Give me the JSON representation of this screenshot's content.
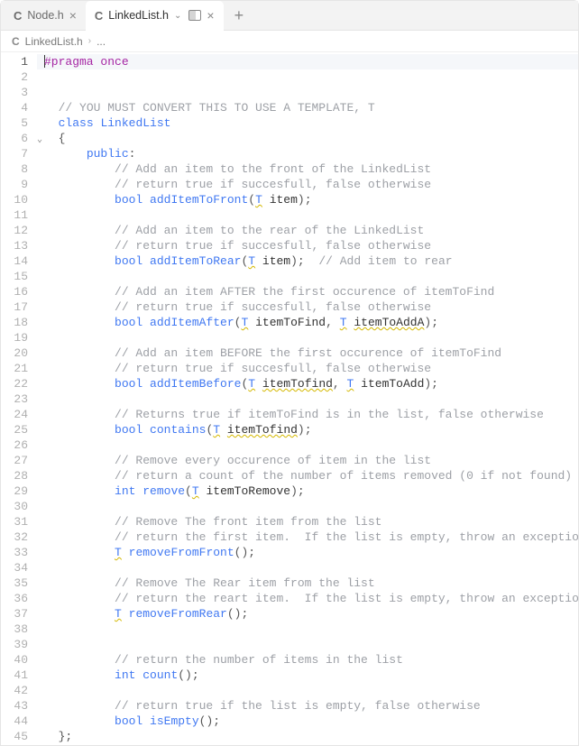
{
  "tabs": [
    {
      "icon": "C",
      "label": "Node.h",
      "active": false
    },
    {
      "icon": "C",
      "label": "LinkedList.h",
      "active": true
    }
  ],
  "breadcrumb": {
    "icon": "C",
    "file": "LinkedList.h",
    "sep": "›",
    "rest": "..."
  },
  "new_tab_label": "+",
  "active_line": 1,
  "fold_line": 6,
  "line_count": 45,
  "code_lines": [
    [
      {
        "c": "cursor"
      },
      {
        "c": "kw-pre",
        "t": "#pragma"
      },
      {
        "t": " "
      },
      {
        "c": "kw-mod",
        "t": "once"
      }
    ],
    [],
    [],
    [
      {
        "t": "  "
      },
      {
        "c": "cm",
        "t": "// YOU MUST CONVERT THIS TO USE A TEMPLATE, T"
      }
    ],
    [
      {
        "t": "  "
      },
      {
        "c": "kw-class",
        "t": "class"
      },
      {
        "t": " "
      },
      {
        "c": "kw-type",
        "t": "LinkedList"
      }
    ],
    [
      {
        "t": "  "
      },
      {
        "c": "pn",
        "t": "{"
      }
    ],
    [
      {
        "t": "      "
      },
      {
        "c": "kw-scope",
        "t": "public"
      },
      {
        "c": "pn",
        "t": ":"
      }
    ],
    [
      {
        "t": "          "
      },
      {
        "c": "cm",
        "t": "// Add an item to the front of the LinkedList"
      }
    ],
    [
      {
        "t": "          "
      },
      {
        "c": "cm",
        "t": "// return true if succesfull, false otherwise"
      }
    ],
    [
      {
        "t": "          "
      },
      {
        "c": "kw-type",
        "t": "bool"
      },
      {
        "t": " "
      },
      {
        "c": "fn",
        "t": "addItemToFront"
      },
      {
        "c": "pn",
        "t": "("
      },
      {
        "c": "ty",
        "t": "T"
      },
      {
        "t": " item"
      },
      {
        "c": "pn",
        "t": ");"
      }
    ],
    [],
    [
      {
        "t": "          "
      },
      {
        "c": "cm",
        "t": "// Add an item to the rear of the LinkedList"
      }
    ],
    [
      {
        "t": "          "
      },
      {
        "c": "cm",
        "t": "// return true if succesfull, false otherwise"
      }
    ],
    [
      {
        "t": "          "
      },
      {
        "c": "kw-type",
        "t": "bool"
      },
      {
        "t": " "
      },
      {
        "c": "fn",
        "t": "addItemToRear"
      },
      {
        "c": "pn",
        "t": "("
      },
      {
        "c": "ty",
        "t": "T"
      },
      {
        "t": " item"
      },
      {
        "c": "pn",
        "t": ");"
      },
      {
        "t": "  "
      },
      {
        "c": "cm",
        "t": "// Add item to rear"
      }
    ],
    [],
    [
      {
        "t": "          "
      },
      {
        "c": "cm",
        "t": "// Add an item AFTER the first occurence of itemToFind"
      }
    ],
    [
      {
        "t": "          "
      },
      {
        "c": "cm",
        "t": "// return true if succesfull, false otherwise"
      }
    ],
    [
      {
        "t": "          "
      },
      {
        "c": "kw-type",
        "t": "bool"
      },
      {
        "t": " "
      },
      {
        "c": "fn",
        "t": "addItemAfter"
      },
      {
        "c": "pn",
        "t": "("
      },
      {
        "c": "ty",
        "t": "T"
      },
      {
        "t": " itemToFind"
      },
      {
        "c": "pn",
        "t": ","
      },
      {
        "t": " "
      },
      {
        "c": "ty",
        "t": "T"
      },
      {
        "t": " "
      },
      {
        "c": "warn-u",
        "t": "itemToAddA"
      },
      {
        "c": "pn",
        "t": ");"
      }
    ],
    [],
    [
      {
        "t": "          "
      },
      {
        "c": "cm",
        "t": "// Add an item BEFORE the first occurence of itemToFind"
      }
    ],
    [
      {
        "t": "          "
      },
      {
        "c": "cm",
        "t": "// return true if succesfull, false otherwise"
      }
    ],
    [
      {
        "t": "          "
      },
      {
        "c": "kw-type",
        "t": "bool"
      },
      {
        "t": " "
      },
      {
        "c": "fn",
        "t": "addItemBefore"
      },
      {
        "c": "pn",
        "t": "("
      },
      {
        "c": "ty",
        "t": "T"
      },
      {
        "t": " "
      },
      {
        "c": "warn-u",
        "t": "itemTofind"
      },
      {
        "c": "pn",
        "t": ","
      },
      {
        "t": " "
      },
      {
        "c": "ty",
        "t": "T"
      },
      {
        "t": " itemToAdd"
      },
      {
        "c": "pn",
        "t": ");"
      }
    ],
    [],
    [
      {
        "t": "          "
      },
      {
        "c": "cm",
        "t": "// Returns true if itemToFind is in the list, false otherwise"
      }
    ],
    [
      {
        "t": "          "
      },
      {
        "c": "kw-type",
        "t": "bool"
      },
      {
        "t": " "
      },
      {
        "c": "fn",
        "t": "contains"
      },
      {
        "c": "pn",
        "t": "("
      },
      {
        "c": "ty",
        "t": "T"
      },
      {
        "t": " "
      },
      {
        "c": "warn-u",
        "t": "itemTofind"
      },
      {
        "c": "pn",
        "t": ");"
      }
    ],
    [],
    [
      {
        "t": "          "
      },
      {
        "c": "cm",
        "t": "// Remove every occurence of item in the list"
      }
    ],
    [
      {
        "t": "          "
      },
      {
        "c": "cm",
        "t": "// return a count of the number of items removed (0 if not found)"
      }
    ],
    [
      {
        "t": "          "
      },
      {
        "c": "kw-type",
        "t": "int"
      },
      {
        "t": " "
      },
      {
        "c": "fn",
        "t": "remove"
      },
      {
        "c": "pn",
        "t": "("
      },
      {
        "c": "ty",
        "t": "T"
      },
      {
        "t": " itemToRemove"
      },
      {
        "c": "pn",
        "t": ");"
      }
    ],
    [],
    [
      {
        "t": "          "
      },
      {
        "c": "cm",
        "t": "// Remove The front item from the list"
      }
    ],
    [
      {
        "t": "          "
      },
      {
        "c": "cm",
        "t": "// return the first item.  If the list is empty, throw an exception"
      }
    ],
    [
      {
        "t": "          "
      },
      {
        "c": "ty",
        "t": "T"
      },
      {
        "t": " "
      },
      {
        "c": "fn",
        "t": "removeFromFront"
      },
      {
        "c": "pn",
        "t": "();"
      }
    ],
    [],
    [
      {
        "t": "          "
      },
      {
        "c": "cm",
        "t": "// Remove The Rear item from the list"
      }
    ],
    [
      {
        "t": "          "
      },
      {
        "c": "cm",
        "t": "// return the reart item.  If the list is empty, throw an exception"
      }
    ],
    [
      {
        "t": "          "
      },
      {
        "c": "ty",
        "t": "T"
      },
      {
        "t": " "
      },
      {
        "c": "fn",
        "t": "removeFromRear"
      },
      {
        "c": "pn",
        "t": "();"
      }
    ],
    [],
    [],
    [
      {
        "t": "          "
      },
      {
        "c": "cm",
        "t": "// return the number of items in the list"
      }
    ],
    [
      {
        "t": "          "
      },
      {
        "c": "kw-type",
        "t": "int"
      },
      {
        "t": " "
      },
      {
        "c": "fn",
        "t": "count"
      },
      {
        "c": "pn",
        "t": "();"
      }
    ],
    [],
    [
      {
        "t": "          "
      },
      {
        "c": "cm",
        "t": "// return true if the list is empty, false otherwise"
      }
    ],
    [
      {
        "t": "          "
      },
      {
        "c": "kw-type",
        "t": "bool"
      },
      {
        "t": " "
      },
      {
        "c": "fn",
        "t": "isEmpty"
      },
      {
        "c": "pn",
        "t": "();"
      }
    ],
    [
      {
        "t": "  "
      },
      {
        "c": "pn",
        "t": "};"
      }
    ]
  ]
}
